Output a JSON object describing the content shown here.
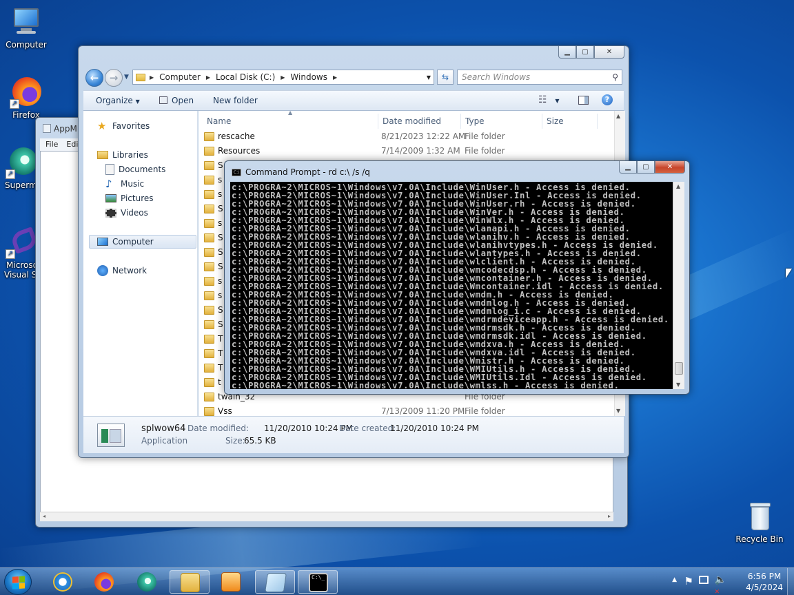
{
  "desktop": {
    "icons": [
      {
        "label": "Computer"
      },
      {
        "label": "Firefox"
      },
      {
        "label": "Supermi"
      },
      {
        "label": "Microso\nVisual St"
      },
      {
        "label": "Recycle Bin"
      }
    ]
  },
  "appm": {
    "title": "AppM",
    "menu": [
      "File",
      "Edi"
    ]
  },
  "explorer": {
    "breadcrumb": [
      "Computer",
      "Local Disk (C:)",
      "Windows"
    ],
    "search_placeholder": "Search Windows",
    "toolbar": {
      "organize": "Organize",
      "open": "Open",
      "new_folder": "New folder"
    },
    "nav": {
      "favorites": "Favorites",
      "libraries": "Libraries",
      "documents": "Documents",
      "music": "Music",
      "pictures": "Pictures",
      "videos": "Videos",
      "computer": "Computer",
      "network": "Network"
    },
    "columns": {
      "name": "Name",
      "date": "Date modified",
      "type": "Type",
      "size": "Size"
    },
    "rows": [
      {
        "name": "rescache",
        "date": "8/21/2023 12:22 AM",
        "type": "File folder"
      },
      {
        "name": "Resources",
        "date": "7/14/2009 1:32 AM",
        "type": "File folder"
      },
      {
        "name": "S",
        "date": "",
        "type": ""
      },
      {
        "name": "s",
        "date": "",
        "type": ""
      },
      {
        "name": "s",
        "date": "",
        "type": ""
      },
      {
        "name": "S",
        "date": "",
        "type": ""
      },
      {
        "name": "s",
        "date": "",
        "type": ""
      },
      {
        "name": "S",
        "date": "",
        "type": ""
      },
      {
        "name": "S",
        "date": "",
        "type": ""
      },
      {
        "name": "S",
        "date": "",
        "type": ""
      },
      {
        "name": "s",
        "date": "",
        "type": ""
      },
      {
        "name": "s",
        "date": "",
        "type": ""
      },
      {
        "name": "S",
        "date": "",
        "type": ""
      },
      {
        "name": "S",
        "date": "",
        "type": ""
      },
      {
        "name": "T",
        "date": "",
        "type": ""
      },
      {
        "name": "T",
        "date": "",
        "type": ""
      },
      {
        "name": "T",
        "date": "",
        "type": ""
      },
      {
        "name": "t",
        "date": "",
        "type": ""
      },
      {
        "name": "twain_32",
        "date": "",
        "type": "File folder"
      },
      {
        "name": "Vss",
        "date": "7/13/2009 11:20 PM",
        "type": "File folder"
      }
    ],
    "details": {
      "name": "splwow64",
      "kind": "Application",
      "modified_label": "Date modified:",
      "modified": "11/20/2010 10:24 PM",
      "created_label": "Date created:",
      "created": "11/20/2010 10:24 PM",
      "size_label": "Size:",
      "size": "65.5 KB"
    }
  },
  "cmd": {
    "title": "Command Prompt - rd  c:\\ /s /q",
    "lines": [
      "c:\\PROGRA~2\\MICROS~1\\Windows\\v7.0A\\Include\\WinUser.h - Access is denied.",
      "c:\\PROGRA~2\\MICROS~1\\Windows\\v7.0A\\Include\\WinUser.Inl - Access is denied.",
      "c:\\PROGRA~2\\MICROS~1\\Windows\\v7.0A\\Include\\WinUser.rh - Access is denied.",
      "c:\\PROGRA~2\\MICROS~1\\Windows\\v7.0A\\Include\\WinVer.h - Access is denied.",
      "c:\\PROGRA~2\\MICROS~1\\Windows\\v7.0A\\Include\\WinWlx.h - Access is denied.",
      "c:\\PROGRA~2\\MICROS~1\\Windows\\v7.0A\\Include\\wlanapi.h - Access is denied.",
      "c:\\PROGRA~2\\MICROS~1\\Windows\\v7.0A\\Include\\wlanihv.h - Access is denied.",
      "c:\\PROGRA~2\\MICROS~1\\Windows\\v7.0A\\Include\\wlanihvtypes.h - Access is denied.",
      "c:\\PROGRA~2\\MICROS~1\\Windows\\v7.0A\\Include\\wlantypes.h - Access is denied.",
      "c:\\PROGRA~2\\MICROS~1\\Windows\\v7.0A\\Include\\wlclient.h - Access is denied.",
      "c:\\PROGRA~2\\MICROS~1\\Windows\\v7.0A\\Include\\wmcodecdsp.h - Access is denied.",
      "c:\\PROGRA~2\\MICROS~1\\Windows\\v7.0A\\Include\\wmcontainer.h - Access is denied.",
      "c:\\PROGRA~2\\MICROS~1\\Windows\\v7.0A\\Include\\Wmcontainer.idl - Access is denied.",
      "c:\\PROGRA~2\\MICROS~1\\Windows\\v7.0A\\Include\\wmdm.h - Access is denied.",
      "c:\\PROGRA~2\\MICROS~1\\Windows\\v7.0A\\Include\\wmdmlog.h - Access is denied.",
      "c:\\PROGRA~2\\MICROS~1\\Windows\\v7.0A\\Include\\wmdmlog_i.c - Access is denied.",
      "c:\\PROGRA~2\\MICROS~1\\Windows\\v7.0A\\Include\\wmdrmdeviceapp.h - Access is denied.",
      "c:\\PROGRA~2\\MICROS~1\\Windows\\v7.0A\\Include\\wmdrmsdk.h - Access is denied.",
      "c:\\PROGRA~2\\MICROS~1\\Windows\\v7.0A\\Include\\wmdrmsdk.idl - Access is denied.",
      "c:\\PROGRA~2\\MICROS~1\\Windows\\v7.0A\\Include\\wmdxva.h - Access is denied.",
      "c:\\PROGRA~2\\MICROS~1\\Windows\\v7.0A\\Include\\wmdxva.idl - Access is denied.",
      "c:\\PROGRA~2\\MICROS~1\\Windows\\v7.0A\\Include\\Wmistr.h - Access is denied.",
      "c:\\PROGRA~2\\MICROS~1\\Windows\\v7.0A\\Include\\WMIUtils.h - Access is denied.",
      "c:\\PROGRA~2\\MICROS~1\\Windows\\v7.0A\\Include\\WMIUtils.Idl - Access is denied.",
      "c:\\PROGRA~2\\MICROS~1\\Windows\\v7.0A\\Include\\wmlss.h - Access is denied."
    ]
  },
  "taskbar": {
    "time": "6:56 PM",
    "date": "4/5/2024"
  }
}
